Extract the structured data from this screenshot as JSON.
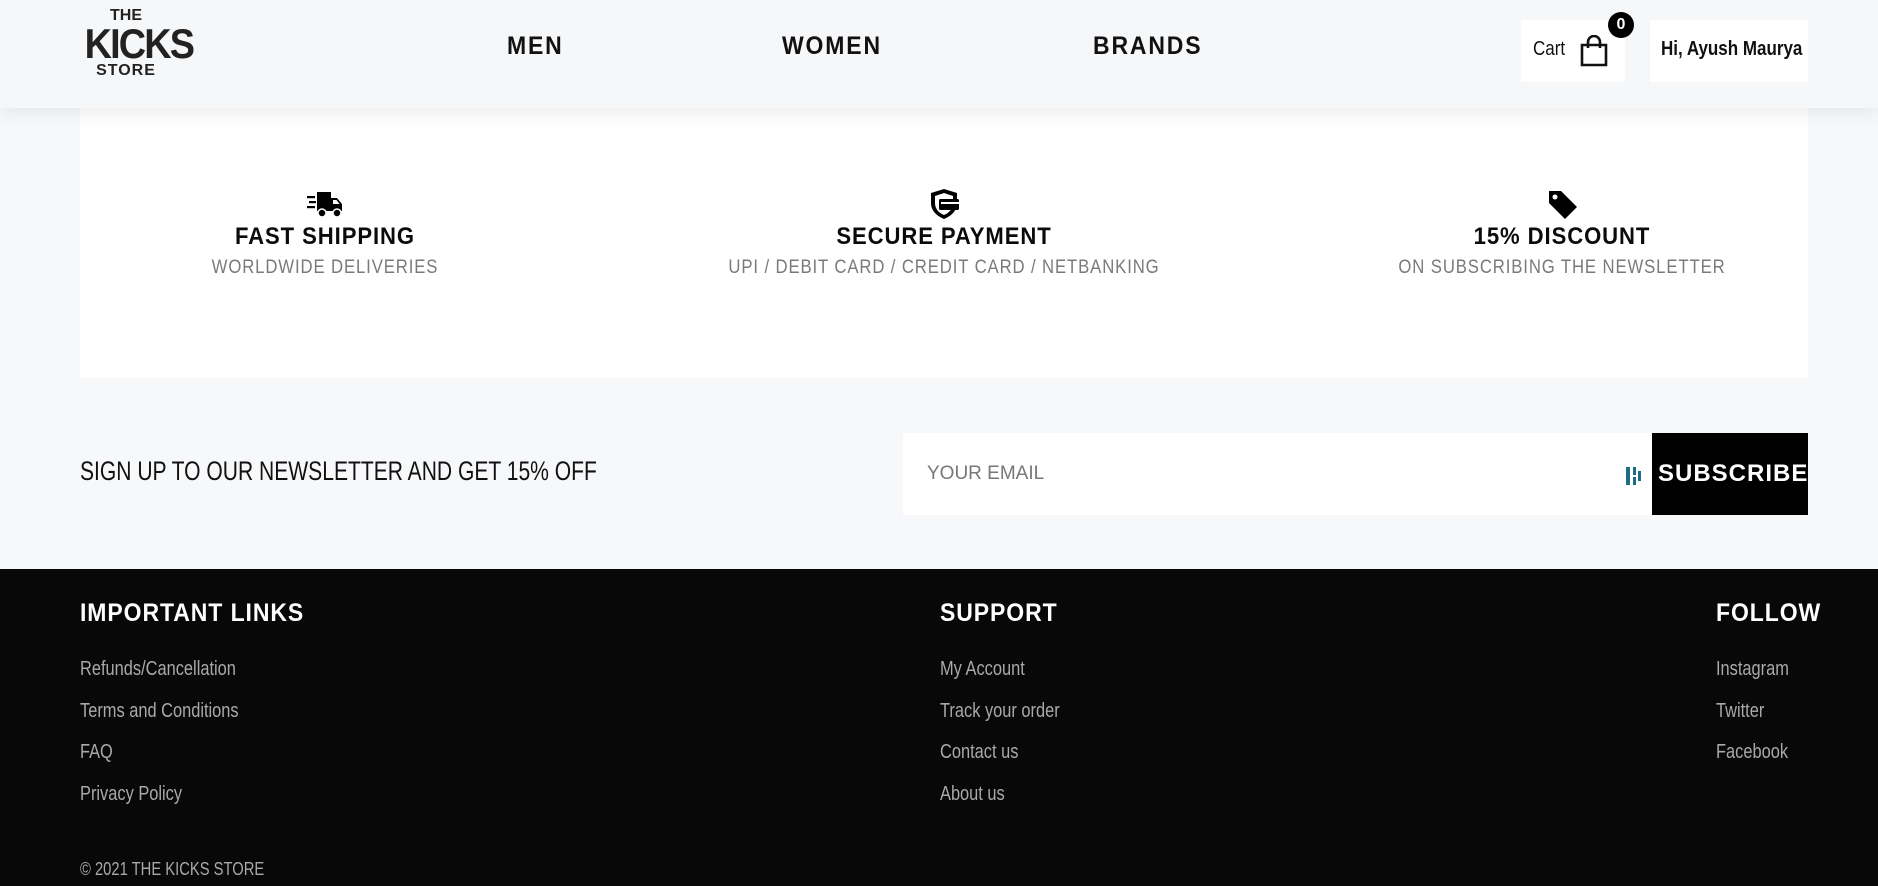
{
  "header": {
    "logo": {
      "line1": "THE",
      "line2": "KICKS",
      "line3": "STORE"
    },
    "nav": [
      {
        "label": "MEN"
      },
      {
        "label": "WOMEN"
      },
      {
        "label": "BRANDS"
      }
    ],
    "cart": {
      "label": "Cart",
      "count": "0",
      "icon": "shopping-bag-icon"
    },
    "user": {
      "greeting": "Hi, Ayush Maurya"
    }
  },
  "features": [
    {
      "icon": "delivery-truck-icon",
      "title": "FAST SHIPPING",
      "subtitle": "WORLDWIDE DELIVERIES"
    },
    {
      "icon": "secure-card-icon",
      "title": "SECURE PAYMENT",
      "subtitle": "UPI / DEBIT CARD / CREDIT CARD / NETBANKING"
    },
    {
      "icon": "price-tag-icon",
      "title": "15% DISCOUNT",
      "subtitle": "ON SUBSCRIBING THE NEWSLETTER"
    }
  ],
  "newsletter": {
    "text": "SIGN UP TO OUR NEWSLETTER AND GET 15% OFF",
    "email_placeholder": "YOUR EMAIL",
    "email_value": "",
    "button_label": "SUBSCRIBE"
  },
  "footer": {
    "columns": [
      {
        "heading": "IMPORTANT LINKS",
        "links": [
          "Refunds/Cancellation",
          "Terms and Conditions",
          "FAQ",
          "Privacy Policy"
        ]
      },
      {
        "heading": "SUPPORT",
        "links": [
          "My Account",
          "Track your order",
          "Contact us",
          "About us"
        ]
      },
      {
        "heading": "FOLLOW",
        "links": [
          "Instagram",
          "Twitter",
          "Facebook"
        ]
      }
    ],
    "copyright": "© 2021 THE KICKS STORE"
  },
  "colors": {
    "page_bg": "#f7f8fa",
    "header_bg": "#f6f7f9",
    "footer_bg": "#080808",
    "accent_dark": "#000000",
    "muted_text": "#7a7a7a",
    "footer_link": "#a9a9a9",
    "extension_icon": "#1d6b84"
  }
}
